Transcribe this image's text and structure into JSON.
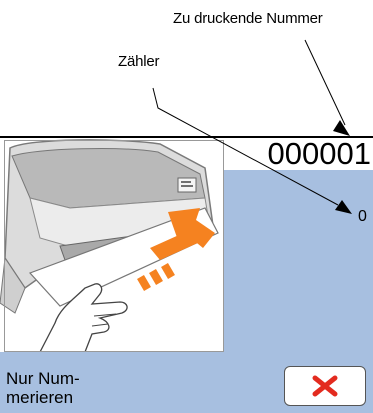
{
  "callouts": {
    "target_number_label": "Zu druckende Nummer",
    "counter_label": "Zähler"
  },
  "display": {
    "number": "000001",
    "counter": "0",
    "caption_line1": "Nur Num-",
    "caption_line2": "merieren"
  },
  "buttons": {
    "cancel_icon": "red-x-icon"
  },
  "colors": {
    "panel_blue": "#a7bfe0",
    "arrow_orange": "#f58220",
    "cancel_red": "#e32b1f"
  }
}
